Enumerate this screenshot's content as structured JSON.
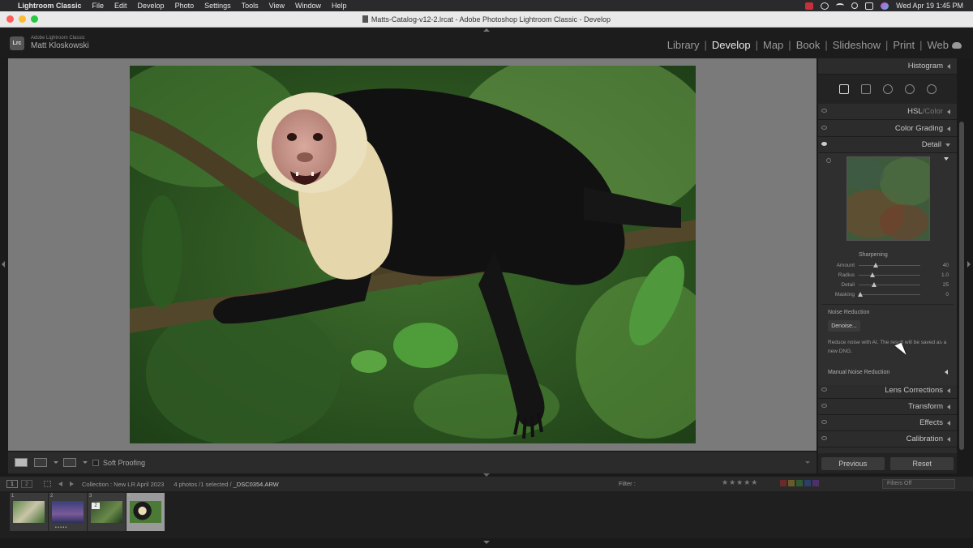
{
  "menubar": {
    "app_name": "Lightroom Classic",
    "items": [
      "File",
      "Edit",
      "Develop",
      "Photo",
      "Settings",
      "Tools",
      "View",
      "Window",
      "Help"
    ],
    "clock": "Wed Apr 19  1:45 PM"
  },
  "window": {
    "title": "Matts-Catalog-v12-2.lrcat - Adobe Photoshop Lightroom Classic - Develop"
  },
  "identity": {
    "badge": "Lrc",
    "line1": "Adobe Lightroom Classic",
    "line2": "Matt Kloskowski"
  },
  "modules": [
    "Library",
    "Develop",
    "Map",
    "Book",
    "Slideshow",
    "Print",
    "Web"
  ],
  "active_module": "Develop",
  "toolbar": {
    "soft_proofing": "Soft Proofing"
  },
  "right_panel": {
    "histogram": "Histogram",
    "hsl": "HSL",
    "hsl_sep": " / ",
    "color": "Color",
    "color_grading": "Color Grading",
    "detail": "Detail",
    "sharpening": {
      "title": "Sharpening",
      "sliders": [
        {
          "label": "Amount",
          "value": "40",
          "fraction": 0.27
        },
        {
          "label": "Radius",
          "value": "1.0",
          "fraction": 0.22
        },
        {
          "label": "Detail",
          "value": "25",
          "fraction": 0.25
        },
        {
          "label": "Masking",
          "value": "0",
          "fraction": 0.02
        }
      ]
    },
    "noise_reduction": {
      "title": "Noise Reduction",
      "denoise_button": "Denoise...",
      "description": "Reduce noise with AI. The result will be saved as a new DNG.",
      "manual": "Manual Noise Reduction"
    },
    "lens_corrections": "Lens Corrections",
    "transform": "Transform",
    "effects": "Effects",
    "calibration": "Calibration",
    "previous": "Previous",
    "reset": "Reset"
  },
  "filmbar": {
    "page1": "1",
    "page2": "2",
    "collection": "Collection : New LR April 2023",
    "count": "4 photos /1 selected /",
    "filename": "_DSC0354.ARW",
    "filter_label": "Filter :",
    "filters_off": "Filters Off",
    "stars": "★★★★★"
  },
  "filmstrip": {
    "thumbs": [
      {
        "num": "1",
        "stack": "",
        "dots": ""
      },
      {
        "num": "2",
        "stack": "",
        "dots": "• • • • •"
      },
      {
        "num": "3",
        "stack": "2",
        "dots": ""
      },
      {
        "num": "4",
        "stack": "",
        "dots": ""
      }
    ]
  }
}
